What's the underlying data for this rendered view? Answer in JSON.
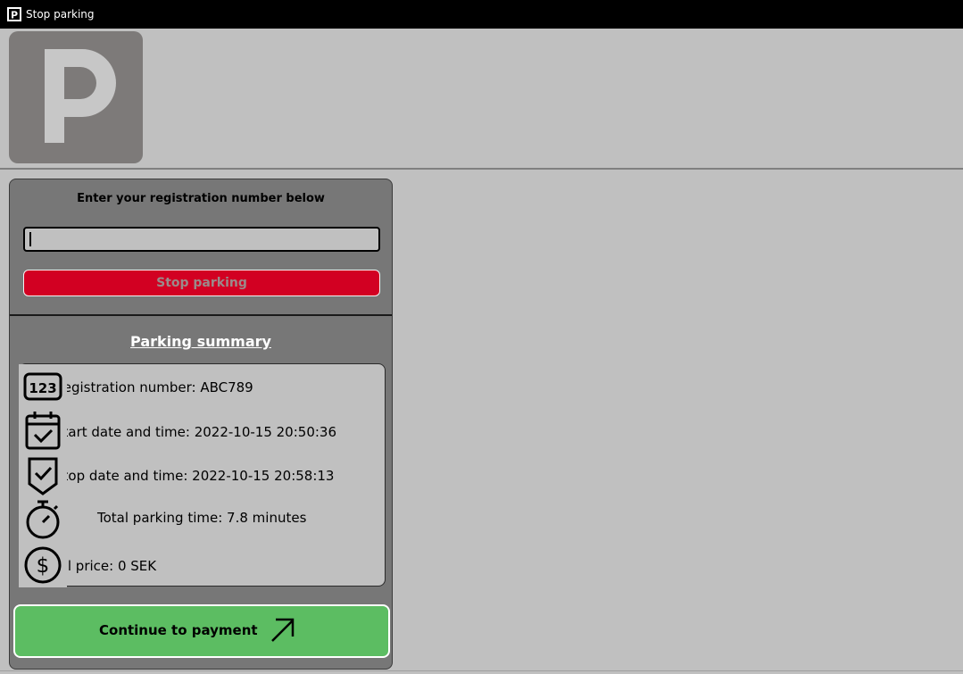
{
  "window": {
    "title": "Stop parking",
    "app_icon": "parking-icon"
  },
  "logo": {
    "letter": "P",
    "icon": "parking-logo"
  },
  "form": {
    "heading": "Enter your registration number below",
    "registration_value": "",
    "stop_button_label": "Stop parking",
    "colors": {
      "stop_button": "#d20022",
      "panel": "#777777"
    }
  },
  "summary": {
    "title": "Parking summary",
    "rows": [
      {
        "icon": "number-123-icon",
        "text": "Registration number: ABC789"
      },
      {
        "icon": "calendar-check-icon",
        "text": "Start date and time: 2022-10-15 20:50:36"
      },
      {
        "icon": "shield-check-icon",
        "text": "Stop date and time: 2022-10-15 20:58:13"
      },
      {
        "icon": "stopwatch-icon",
        "text": "Total parking time: 7.8 minutes"
      },
      {
        "icon": "dollar-coin-icon",
        "text": "Total price: 0 SEK"
      }
    ]
  },
  "payment": {
    "button_label": "Continue to payment",
    "icon": "arrow-up-right-icon",
    "color": "#5cbd62"
  }
}
